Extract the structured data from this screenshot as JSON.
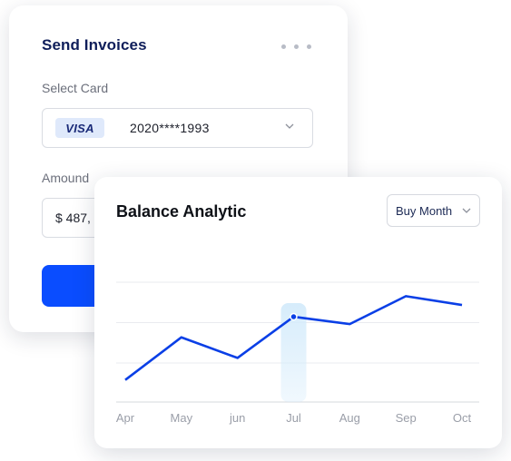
{
  "invoice": {
    "title": "Send Invoices",
    "more_icon": "more-horizontal-icon",
    "select_card_label": "Select Card",
    "card_brand": "VISA",
    "card_number": "2020****1993",
    "amount_label": "Amound",
    "amount_value": "$ 487,",
    "colors": {
      "title": "#0f1e5a",
      "button": "#0a4dff",
      "badge_bg": "#dfe9fb"
    }
  },
  "analytic": {
    "title": "Balance Analytic",
    "period_select": "Buy Month",
    "colors": {
      "line": "#0a3fe6",
      "highlight": "#d6ecfb",
      "grid": "#e9ebef"
    }
  },
  "chart_data": {
    "type": "line",
    "categories": [
      "Apr",
      "May",
      "jun",
      "Jul",
      "Aug",
      "Sep",
      "Oct"
    ],
    "values": [
      15,
      44,
      30,
      58,
      53,
      72,
      66
    ],
    "highlighted": "Jul",
    "ylim": [
      0,
      100
    ],
    "grid": true,
    "title": "Balance Analytic"
  }
}
